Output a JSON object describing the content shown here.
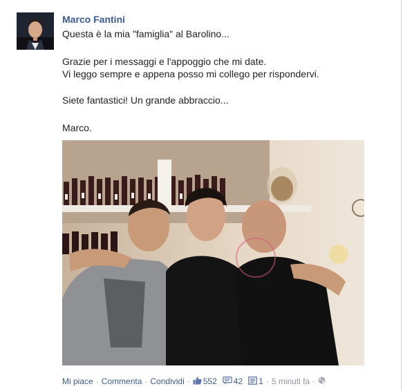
{
  "post": {
    "author": "Marco Fantini",
    "lines": [
      "Questa è la mia \"famiglia\" al Barolino...",
      "Grazie per i messaggi e l'appoggio che mi date.",
      "Vi leggo sempre e appena posso mi collego per rispondervi.",
      "Siete fantastici! Un grande abbraccio...",
      "Marco."
    ]
  },
  "actions": {
    "like": "Mi piace",
    "comment": "Commenta",
    "share": "Condividi",
    "likes_count": "552",
    "comments_count": "42",
    "shares_count": "1",
    "time": "5 minuti fa",
    "separator": "·"
  },
  "icons": {
    "like": "thumbs-up-icon",
    "comment": "comment-icon",
    "share": "share-icon",
    "audience": "globe-icon"
  },
  "colors": {
    "link": "#3b5998",
    "meta": "#8f94a0"
  }
}
